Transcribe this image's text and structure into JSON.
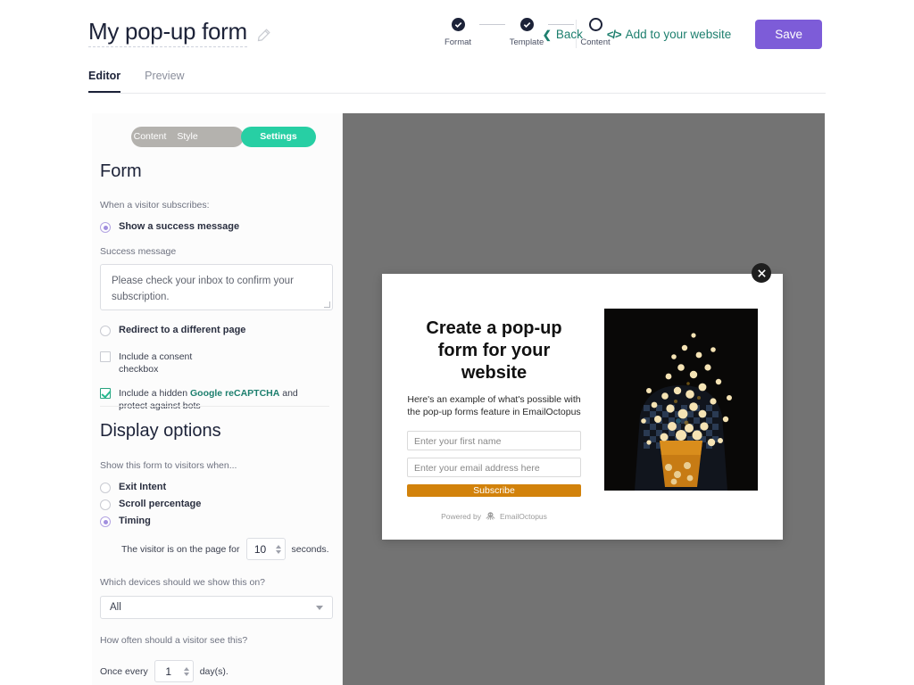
{
  "header": {
    "page_title": "My pop-up form",
    "edit_icon": "pencil-icon",
    "steps": [
      {
        "label": "Format",
        "state": "done"
      },
      {
        "label": "Template",
        "state": "done"
      },
      {
        "label": "Content",
        "state": "current"
      }
    ],
    "back_label": "Back",
    "back_chevron": "chevron-left-icon",
    "embed_label": "Add to your website",
    "embed_icon": "code-icon",
    "save_label": "Save",
    "save_color": "#7d5cd8",
    "link_color": "#1d7f6e"
  },
  "tabs": [
    {
      "label": "Editor",
      "active": true
    },
    {
      "label": "Preview",
      "active": false
    }
  ],
  "sidebar": {
    "segments": [
      {
        "label": "Content",
        "active": false
      },
      {
        "label": "Style",
        "active": false
      },
      {
        "label": "Settings",
        "active": true
      }
    ],
    "segment_active_color": "#27cfa4",
    "form_section": {
      "heading": "Form",
      "when_label": "When a visitor subscribes:",
      "option_success": "Show a success message",
      "option_redirect": "Redirect to a different page",
      "selected_option": "success",
      "success_message_label": "Success message",
      "success_message_value": "Please check your inbox to confirm your subscription.",
      "consent_label": "Include a consent checkbox",
      "consent_checked": false,
      "recaptcha_prefix": "Include a hidden ",
      "recaptcha_link": "Google reCAPTCHA",
      "recaptcha_suffix": " and protect against bots",
      "recaptcha_checked": true
    },
    "display_section": {
      "heading": "Display options",
      "show_when_label": "Show this form to visitors when...",
      "triggers": [
        {
          "label": "Exit Intent",
          "selected": false
        },
        {
          "label": "Scroll percentage",
          "selected": false
        },
        {
          "label": "Timing",
          "selected": true
        }
      ],
      "timing_prefix": "The visitor is on the page for",
      "timing_value": "10",
      "timing_suffix": "seconds.",
      "devices_label": "Which devices should we show this on?",
      "devices_value": "All",
      "frequency_label": "How often should a visitor see this?",
      "frequency_prefix": "Once every",
      "frequency_value": "1",
      "frequency_suffix": "day(s)."
    }
  },
  "preview": {
    "backdrop_color": "#737373",
    "close_icon": "close-icon",
    "popup": {
      "heading": "Create a pop-up form for your website",
      "subheading": "Here's an example of what's possible with the pop-up forms feature in EmailOctopus",
      "first_name_placeholder": "Enter your first name",
      "email_placeholder": "Enter your email address here",
      "subscribe_label": "Subscribe",
      "subscribe_color": "#d2820b",
      "powered_by_text": "Powered by",
      "brand_name": "EmailOctopus",
      "brand_icon": "octopus-icon",
      "image_alt": "popcorn bursting out of a striped bucket on a dark background"
    }
  }
}
